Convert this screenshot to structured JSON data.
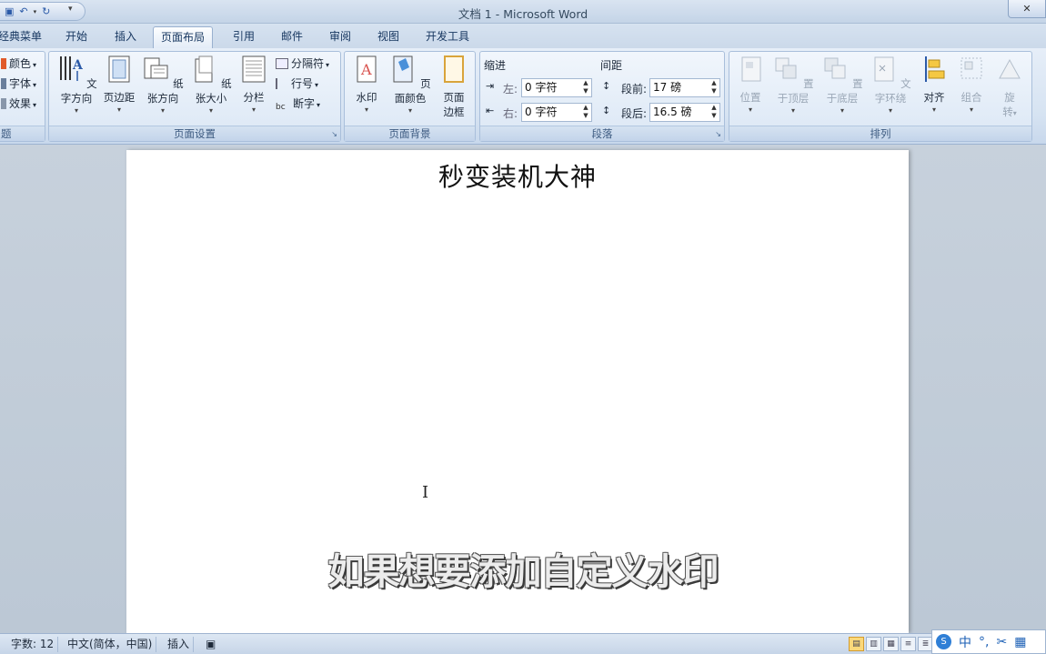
{
  "window": {
    "title": "文档 1 - Microsoft Word"
  },
  "tabs": [
    "经典菜单",
    "开始",
    "插入",
    "页面布局",
    "引用",
    "邮件",
    "审阅",
    "视图",
    "开发工具"
  ],
  "active_tab": "页面布局",
  "theme_group": {
    "colors": "颜色",
    "fonts": "字体",
    "effects": "效果",
    "label": "题"
  },
  "page_setup": {
    "label": "页面设置",
    "text_direction": "文字方向",
    "margins": "页边距",
    "orientation": "纸张方向",
    "size": "纸张大小",
    "columns": "分栏",
    "breaks": "分隔符",
    "line_numbers": "行号",
    "hyphenation": "断字"
  },
  "page_background": {
    "label": "页面背景",
    "watermark": "水印",
    "page_color": "页面颜色",
    "page_borders_1": "页面",
    "page_borders_2": "边框"
  },
  "paragraph": {
    "label": "段落",
    "indent_title": "缩进",
    "spacing_title": "间距",
    "left_label": "左:",
    "right_label": "右:",
    "before_label": "段前:",
    "after_label": "段后:",
    "left_value": "0 字符",
    "right_value": "0 字符",
    "before_value": "17 磅",
    "after_value": "16.5 磅"
  },
  "arrange": {
    "label": "排列",
    "position": "位置",
    "bring_front": "置于顶层",
    "send_back": "置于底层",
    "wrap_text": "文字环绕",
    "align": "对齐",
    "group": "组合",
    "rotate_1": "旋",
    "rotate_2": "转"
  },
  "document": {
    "title_text": "秒变装机大神"
  },
  "caption": "如果想要添加自定义水印",
  "status": {
    "word_count": "字数: 12",
    "language": "中文(简体，中国)",
    "mode": "插入"
  },
  "ime": {
    "lang": "中"
  },
  "colors": {
    "accent": "#2b5aa8",
    "ribbon": "#dbe7f5"
  }
}
